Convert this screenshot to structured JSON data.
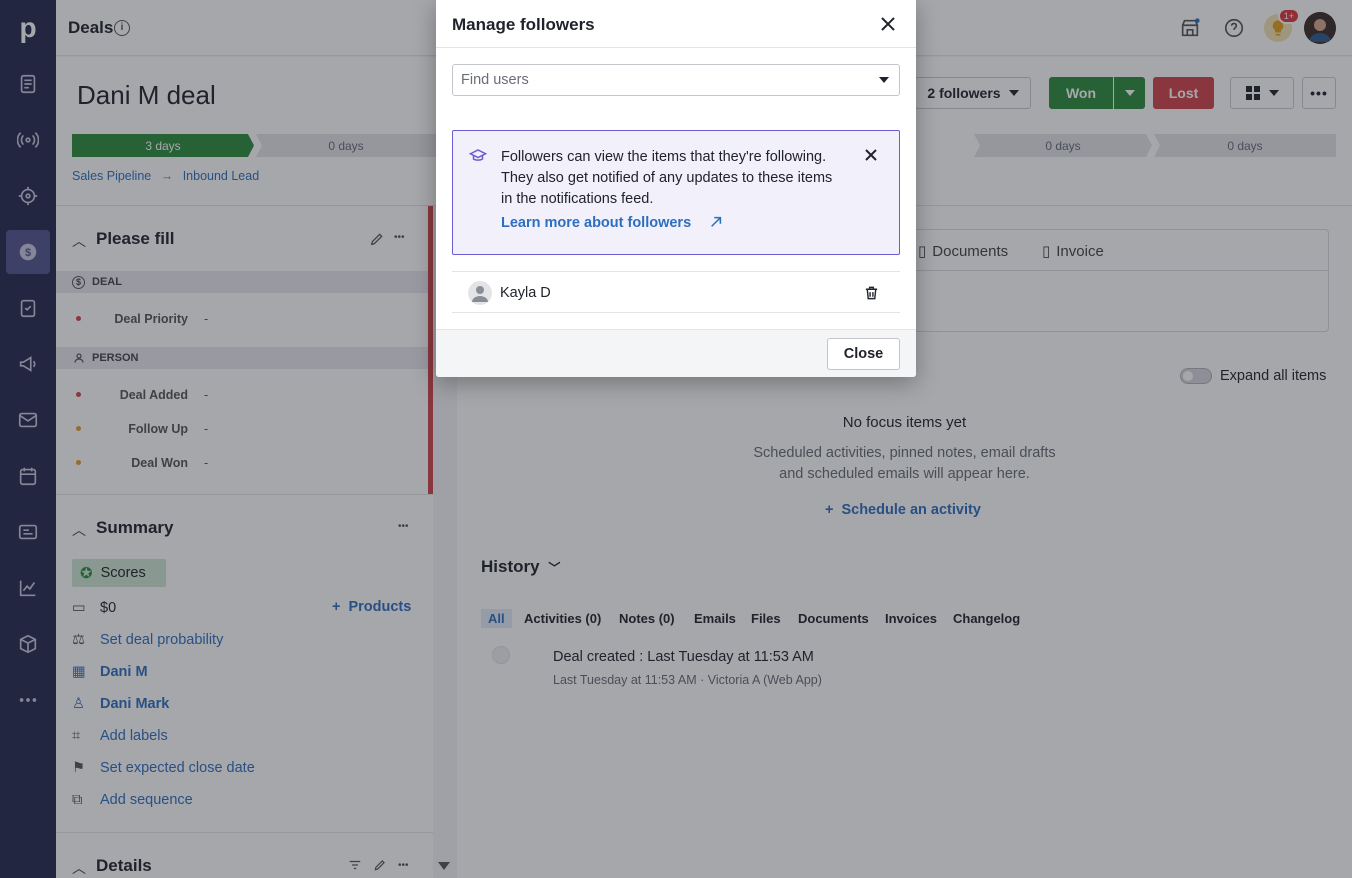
{
  "app": {
    "logo": "p"
  },
  "nav": {
    "items": [
      {
        "icon": "leads-icon"
      },
      {
        "icon": "campaigns-icon"
      },
      {
        "icon": "target-icon"
      },
      {
        "icon": "deals-icon"
      },
      {
        "icon": "activities-icon"
      },
      {
        "icon": "megaphone-icon"
      },
      {
        "icon": "mail-icon"
      },
      {
        "icon": "calendar-icon"
      },
      {
        "icon": "contacts-icon"
      },
      {
        "icon": "insights-icon"
      },
      {
        "icon": "products-icon"
      },
      {
        "icon": "more-icon"
      }
    ]
  },
  "header": {
    "title": "Deals",
    "notification_badge": "1+"
  },
  "deal": {
    "title": "Dani M deal",
    "followers_label": "2 followers",
    "won_label": "Won",
    "lost_label": "Lost",
    "stages_left": [
      "3 days",
      "0 days"
    ],
    "stages_right": [
      "0 days",
      "0 days"
    ],
    "breadcrumb": [
      "Sales Pipeline",
      "Inbound Lead"
    ]
  },
  "please_fill": {
    "title": "Please fill",
    "groups": [
      {
        "label": "DEAL",
        "fields": [
          {
            "label": "Deal Priority",
            "value": "-",
            "color": "#d0444a"
          }
        ]
      },
      {
        "label": "PERSON",
        "fields": [
          {
            "label": "Deal Added",
            "value": "-",
            "color": "#d0444a"
          },
          {
            "label": "Follow Up",
            "value": "-",
            "color": "#e0a030"
          },
          {
            "label": "Deal Won",
            "value": "-",
            "color": "#e0a030"
          }
        ]
      }
    ]
  },
  "summary": {
    "title": "Summary",
    "scores_label": "Scores",
    "value": "$0",
    "products_label": "Products",
    "probability": "Set deal probability",
    "organization": "Dani M",
    "person": "Dani Mark",
    "labels": "Add labels",
    "close_date": "Set expected close date",
    "sequence": "Add sequence"
  },
  "details": {
    "title": "Details"
  },
  "main": {
    "tabs": [
      "Documents",
      "Invoice"
    ],
    "expand_label": "Expand all items",
    "focus_title": "No focus items yet",
    "focus_desc_1": "Scheduled activities, pinned notes, email drafts",
    "focus_desc_2": "and scheduled emails will appear here.",
    "schedule_label": "Schedule an activity",
    "history_title": "History",
    "history_tabs": [
      "All",
      "Activities (0)",
      "Notes (0)",
      "Emails",
      "Files",
      "Documents",
      "Invoices",
      "Changelog"
    ],
    "history_item_title": "Deal created : Last Tuesday at 11:53 AM",
    "history_item_meta": "Last Tuesday at 11:53 AM · Victoria A (Web App)"
  },
  "modal": {
    "title": "Manage followers",
    "find_placeholder": "Find users",
    "info_text": "Followers can view the items that they're following. They also get notified of any updates to these items in the notifications feed.",
    "learn_more": "Learn more about followers",
    "follower_name": "Kayla D",
    "close_label": "Close"
  },
  "colors": {
    "nav_bg": "#26294f",
    "won": "#2c8c3c",
    "lost": "#d0444a",
    "link": "#2e6ebf",
    "info_border": "#6a5cd3"
  }
}
